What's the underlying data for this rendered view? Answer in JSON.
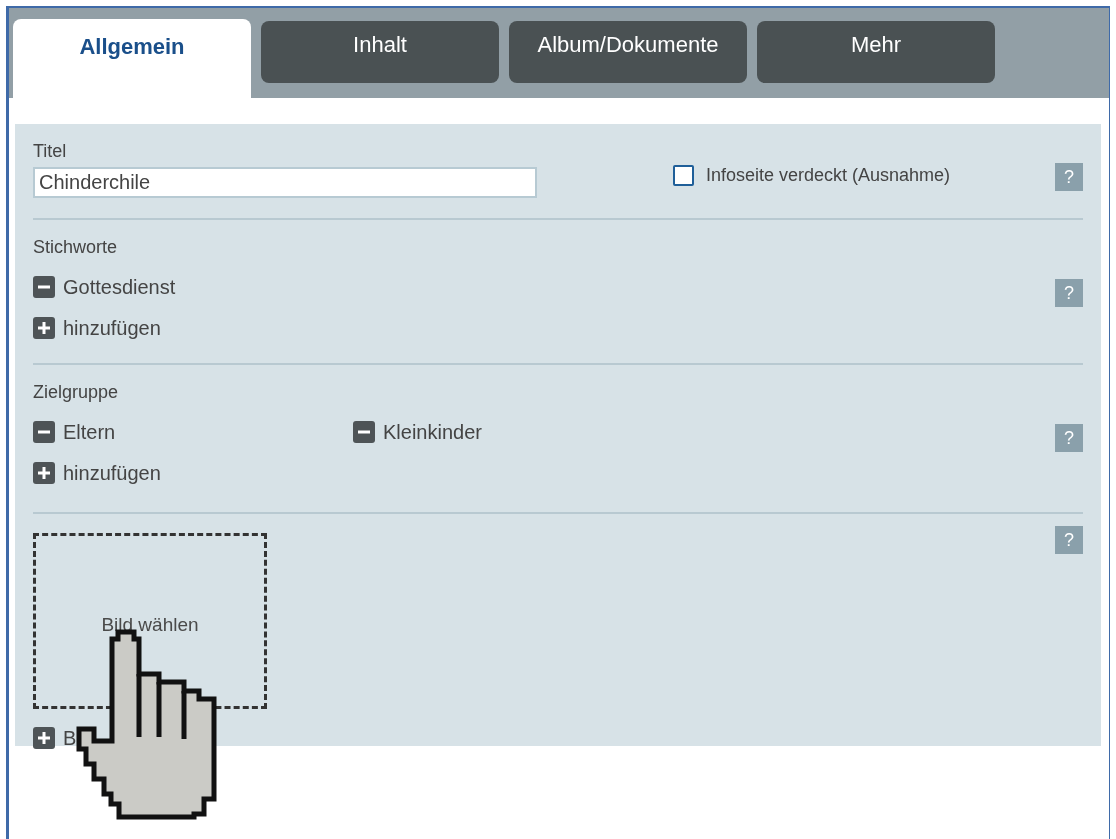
{
  "tabs": [
    {
      "label": "Allgemein",
      "selected": true
    },
    {
      "label": "Inhalt",
      "selected": false
    },
    {
      "label": "Album/Dokumente",
      "selected": false
    },
    {
      "label": "Mehr",
      "selected": false
    }
  ],
  "title_section": {
    "label": "Titel",
    "value": "Chinderchile",
    "checkbox": {
      "label": "Infoseite verdeckt (Ausnahme)",
      "checked": false
    }
  },
  "tag_sections": [
    {
      "label": "Stichworte",
      "tags": [
        "Gottesdienst"
      ],
      "add_label": "hinzufügen"
    },
    {
      "label": "Zielgruppe",
      "tags": [
        "Eltern",
        "Kleinkinder"
      ],
      "add_label": "hinzufügen"
    }
  ],
  "image_section": {
    "drop_label": "Bild wählen",
    "add_label": "B"
  },
  "help_label": "?"
}
